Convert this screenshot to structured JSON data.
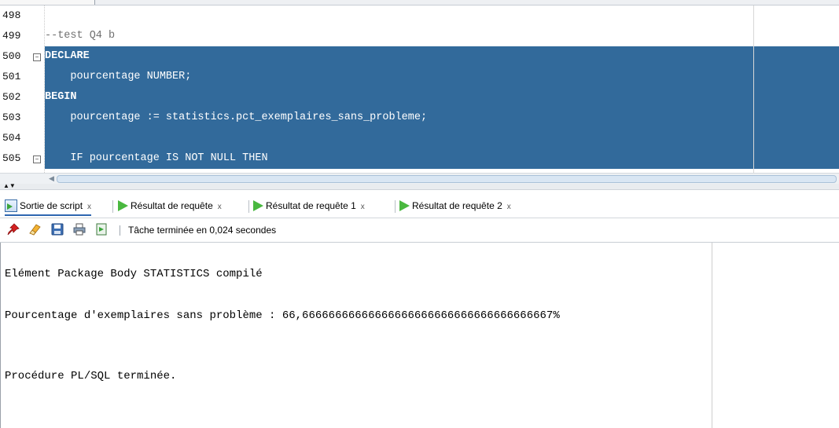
{
  "editor": {
    "lines": [
      {
        "number": "498",
        "text": "",
        "selected": false,
        "style": "plain",
        "fold": false
      },
      {
        "number": "499",
        "text": "--test Q4 b",
        "selected": false,
        "style": "comment",
        "fold": false
      },
      {
        "number": "500",
        "text": "DECLARE",
        "selected": true,
        "style": "keyword",
        "fold": true
      },
      {
        "number": "501",
        "text": "    pourcentage NUMBER;",
        "selected": true,
        "style": "mixed",
        "fold": false
      },
      {
        "number": "502",
        "text": "BEGIN",
        "selected": true,
        "style": "keyword",
        "fold": false
      },
      {
        "number": "503",
        "text": "    pourcentage := statistics.pct_exemplaires_sans_probleme;",
        "selected": true,
        "style": "mixed",
        "fold": false
      },
      {
        "number": "504",
        "text": "",
        "selected": true,
        "style": "plain",
        "fold": false
      },
      {
        "number": "505",
        "text": "    IF pourcentage IS NOT NULL THEN",
        "selected": true,
        "style": "mixed",
        "fold": true
      }
    ]
  },
  "tabs": [
    {
      "label": "Sortie de script",
      "close": "x",
      "icon": "script-output-icon",
      "active": true
    },
    {
      "label": "Résultat de requête",
      "close": "x",
      "icon": "run-icon",
      "active": false
    },
    {
      "label": "Résultat de requête 1",
      "close": "x",
      "icon": "run-icon",
      "active": false
    },
    {
      "label": "Résultat de requête 2",
      "close": "x",
      "icon": "run-icon",
      "active": false
    }
  ],
  "toolbar": {
    "icons": [
      "pin-icon",
      "eraser-icon",
      "save-icon",
      "print-icon",
      "open-file-icon"
    ],
    "status": "Tâche terminée en 0,024 secondes"
  },
  "output": {
    "lines": [
      "Elément Package Body STATISTICS compilé",
      "Pourcentage d'exemplaires sans problème : 66,66666666666666666666666666666666666667%",
      "Procédure PL/SQL terminée."
    ]
  },
  "colors": {
    "selection": "#326a9b",
    "selection_text": "#ffffff",
    "comment": "#707070",
    "run_icon": "#49b83f",
    "active_tab_underline": "#2e66b0"
  }
}
